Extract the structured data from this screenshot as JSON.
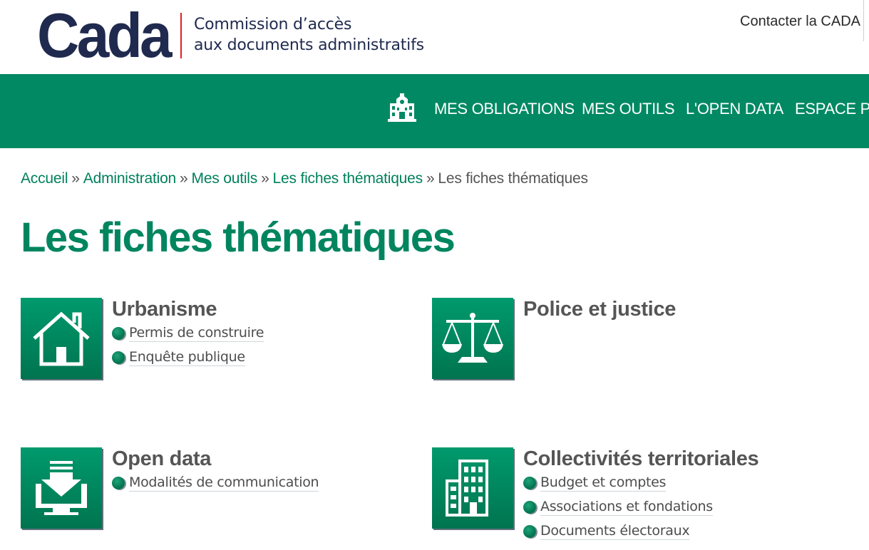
{
  "header": {
    "logo_text": "Cada",
    "tagline_line1": "Commission d’accès",
    "tagline_line2": "aux documents administratifs",
    "contact_label": "Contacter la CADA"
  },
  "nav": {
    "home_icon": "building-icon",
    "items": [
      {
        "label": "MES OBLIGATIONS"
      },
      {
        "label": "MES OUTILS"
      },
      {
        "label": "L'OPEN DATA"
      },
      {
        "label": "ESPACE PRESSE"
      }
    ]
  },
  "breadcrumb": {
    "items": [
      "Accueil",
      "Administration",
      "Mes outils",
      "Les fiches thématiques"
    ],
    "separator": "»",
    "current": "Les fiches thématiques"
  },
  "page": {
    "title": "Les fiches thématiques"
  },
  "cards": [
    {
      "title": "Urbanisme",
      "icon": "house-icon",
      "links": [
        "Permis de construire",
        "Enquête publique"
      ]
    },
    {
      "title": "Police et justice",
      "icon": "scales-icon",
      "links": []
    },
    {
      "title": "Open data",
      "icon": "download-computer-icon",
      "links": [
        "Modalités de communication"
      ]
    },
    {
      "title": "Collectivités territoriales",
      "icon": "city-building-icon",
      "links": [
        "Budget et comptes",
        "Associations et fondations",
        "Documents électoraux"
      ]
    }
  ],
  "colors": {
    "brand_green": "#008963",
    "title_green": "#00855f",
    "logo_navy": "#1f2a4e",
    "logo_red": "#e31e24"
  }
}
